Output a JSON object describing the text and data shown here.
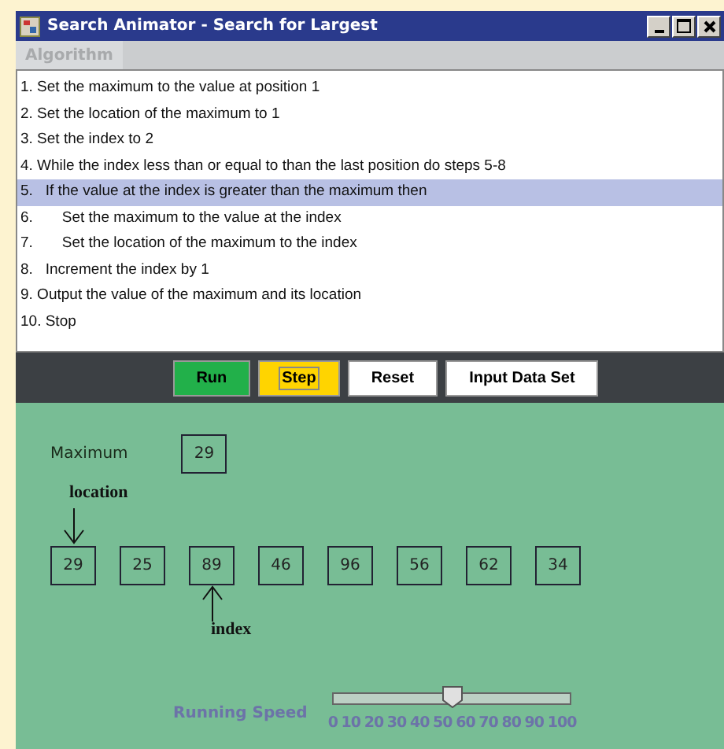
{
  "window": {
    "title": "Search Animator - Search for Largest"
  },
  "menu": [
    {
      "label": "Algorithm",
      "disabled": true
    }
  ],
  "steps": [
    {
      "text": "1. Set the maximum to the value at position 1",
      "selected": false
    },
    {
      "text": "2. Set the location of the maximum to 1",
      "selected": false
    },
    {
      "text": "3. Set the index to 2",
      "selected": false
    },
    {
      "text": "4. While the index less than or equal to than the last position do steps 5-8",
      "selected": false
    },
    {
      "text": "5.   If the value at the index is greater than the maximum then",
      "selected": true
    },
    {
      "text": "6.       Set the maximum to the value at the index",
      "selected": false
    },
    {
      "text": "7.       Set the location of the maximum to the index",
      "selected": false
    },
    {
      "text": "8.   Increment the index by 1",
      "selected": false
    },
    {
      "text": "9. Output the value of the maximum and its location",
      "selected": false
    },
    {
      "text": "10. Stop",
      "selected": false
    }
  ],
  "buttons": [
    {
      "label": "Run",
      "color": "#22b04a",
      "focused": false
    },
    {
      "label": "Step",
      "color": "#ffd400",
      "focused": true
    },
    {
      "label": "Reset",
      "color": "#ffffff",
      "focused": false
    },
    {
      "label": "Input Data Set",
      "color": "#ffffff",
      "focused": false
    }
  ],
  "animation": {
    "maximum_label": "Maximum",
    "maximum_value": "29",
    "location_label": "location",
    "index_label": "index",
    "array": [
      {
        "value": "29",
        "location": true,
        "index": false
      },
      {
        "value": "25",
        "location": false,
        "index": false
      },
      {
        "value": "89",
        "location": false,
        "index": true
      },
      {
        "value": "46",
        "location": false,
        "index": false
      },
      {
        "value": "96",
        "location": false,
        "index": false
      },
      {
        "value": "56",
        "location": false,
        "index": false
      },
      {
        "value": "62",
        "location": false,
        "index": false
      },
      {
        "value": "34",
        "location": false,
        "index": false
      }
    ]
  },
  "speed": {
    "label": "Running Speed",
    "level": 0.5,
    "ticks": [
      "0",
      "10",
      "20",
      "30",
      "40",
      "50",
      "60",
      "70",
      "80",
      "90",
      "100"
    ]
  }
}
